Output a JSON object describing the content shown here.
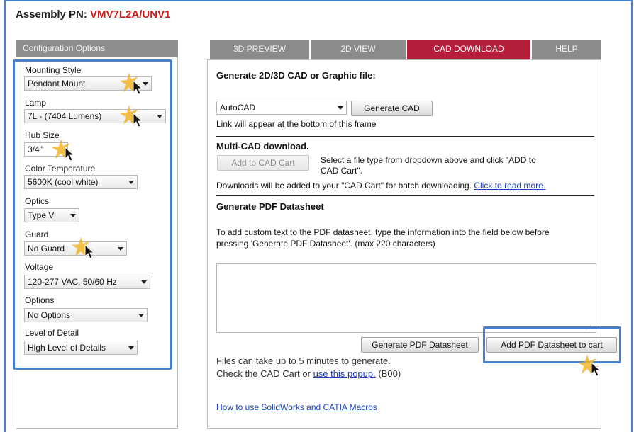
{
  "header": {
    "title_label": "Assembly PN:",
    "part_number": "VMV7L2A/UNV1"
  },
  "config": {
    "header": "Configuration Options",
    "options": [
      {
        "label": "Mounting Style",
        "value": "Pendant Mount"
      },
      {
        "label": "Lamp",
        "value": "7L - (7404 Lumens)"
      },
      {
        "label": "Hub Size",
        "value": "3/4\""
      },
      {
        "label": "Color Temperature",
        "value": "5600K (cool white)"
      },
      {
        "label": "Optics",
        "value": "Type V"
      },
      {
        "label": "Guard",
        "value": "No Guard"
      },
      {
        "label": "Voltage",
        "value": "120-277 VAC, 50/60 Hz"
      },
      {
        "label": "Options",
        "value": "No Options"
      },
      {
        "label": "Level of Detail",
        "value": "High Level of Details"
      }
    ]
  },
  "tabs": [
    {
      "label": "3D PREVIEW",
      "active": false
    },
    {
      "label": "2D VIEW",
      "active": false
    },
    {
      "label": "CAD DOWNLOAD",
      "active": true
    },
    {
      "label": "HELP",
      "active": false
    }
  ],
  "cad": {
    "generate_heading": "Generate 2D/3D CAD or Graphic file:",
    "format_selected": "AutoCAD",
    "generate_button": "Generate CAD",
    "link_note": "Link will appear at the bottom of this frame",
    "multi_heading": "Multi-CAD download.",
    "add_cart_button": "Add to CAD Cart",
    "multi_desc_1": "Select a file type from dropdown above and click \"ADD to",
    "multi_desc_2": "CAD Cart\".",
    "batch_note": "Downloads will be added to your \"CAD Cart\" for batch downloading.",
    "read_more_link": "Click to read more.",
    "pdf_heading": "Generate PDF Datasheet",
    "pdf_desc_1": "To add custom text to the PDF datasheet, type the information into the field below before",
    "pdf_desc_2": "pressing 'Generate PDF Datasheet'. (max 220 characters)",
    "pdf_text_value": "",
    "generate_pdf_button": "Generate PDF Datasheet",
    "add_pdf_button": "Add PDF Datasheet to cart",
    "files_note": "Files can take up to 5 minutes to generate.",
    "check_prefix": "Check the CAD Cart or",
    "popup_link": "use this popup.",
    "check_suffix": "(B00)",
    "macros_link": "How to use SolidWorks and CATIA Macros"
  },
  "colors": {
    "active_tab": "#b51f3c",
    "tab": "#8b8b8b",
    "highlight": "#4a7ec9",
    "part_number": "#d11919",
    "cursor_glow": "#f2b52a"
  }
}
